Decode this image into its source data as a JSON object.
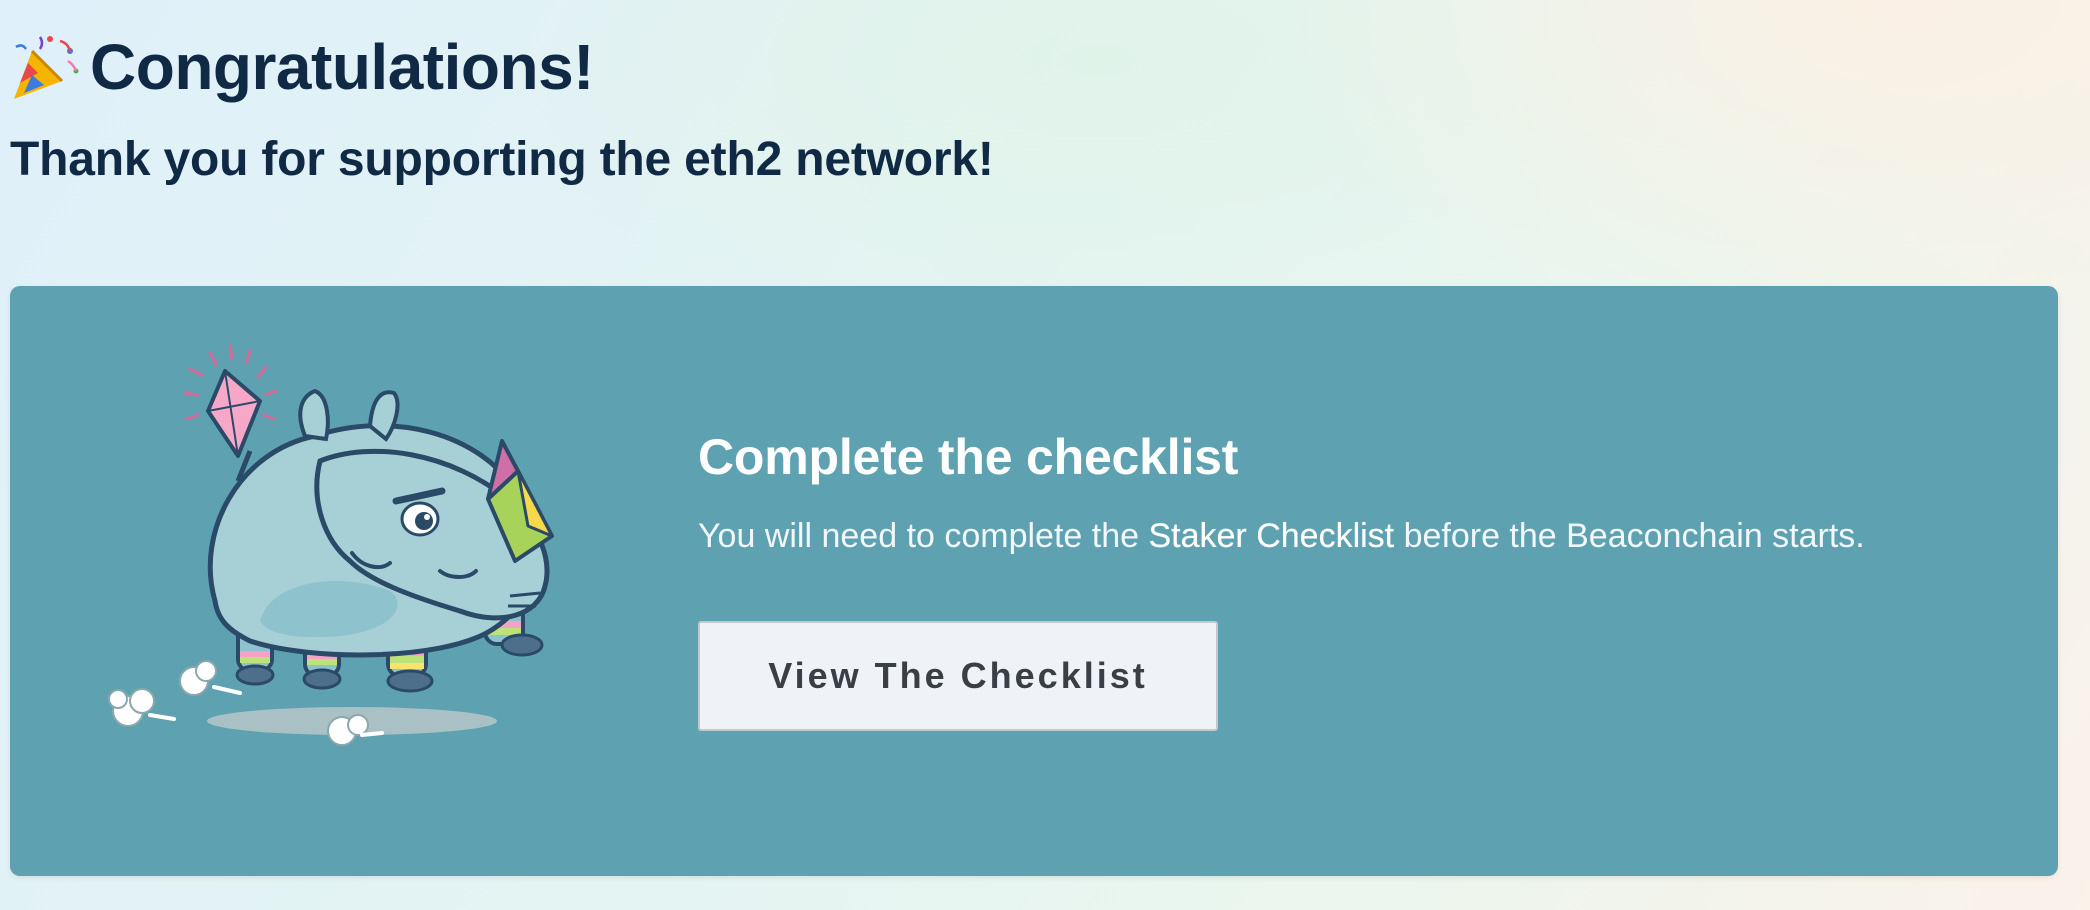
{
  "header": {
    "title": "Congratulations!",
    "subtitle": "Thank you for supporting the eth2 network!",
    "title_icon": "party-popper-icon"
  },
  "card": {
    "illustration": "running-rhino-with-ethereum-diamonds",
    "title": "Complete the checklist",
    "text_before": "You will need to complete the ",
    "text_highlight": "Staker Checklist",
    "text_after": " before the Beaconchain starts.",
    "button_label": "View The Checklist",
    "background_color": "#5ea2b2"
  }
}
